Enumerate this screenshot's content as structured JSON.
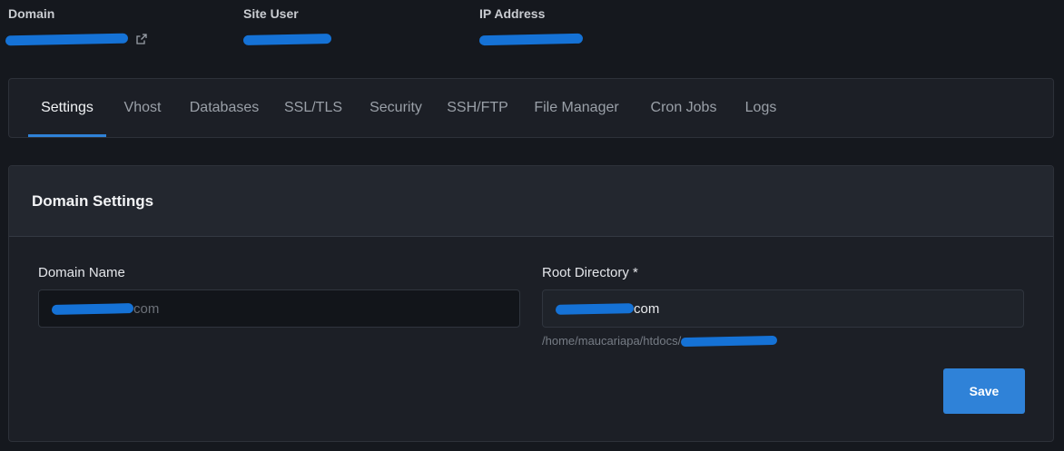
{
  "site_info": {
    "domain": {
      "label": "Domain",
      "value": ""
    },
    "site_user": {
      "label": "Site User",
      "value": ""
    },
    "ip_address": {
      "label": "IP Address",
      "value": ""
    }
  },
  "tabs": [
    {
      "label": "Settings",
      "active": true
    },
    {
      "label": "Vhost",
      "active": false
    },
    {
      "label": "Databases",
      "active": false
    },
    {
      "label": "SSL/TLS",
      "active": false
    },
    {
      "label": "Security",
      "active": false
    },
    {
      "label": "SSH/FTP",
      "active": false
    },
    {
      "label": "File Manager",
      "active": false
    },
    {
      "label": "Cron Jobs",
      "active": false
    },
    {
      "label": "Logs",
      "active": false
    }
  ],
  "domain_settings": {
    "title": "Domain Settings",
    "domain_name": {
      "label": "Domain Name",
      "suffix": "com"
    },
    "root_directory": {
      "label": "Root Directory *",
      "suffix": "com",
      "help_prefix": "/home/maucariapa/htdocs/"
    },
    "save_label": "Save"
  },
  "colors": {
    "accent": "#2f82d8",
    "redaction": "#1572d6",
    "background": "#15181e",
    "panel": "#1c1f26"
  },
  "icons": {
    "domain_link": "external-link-icon"
  }
}
